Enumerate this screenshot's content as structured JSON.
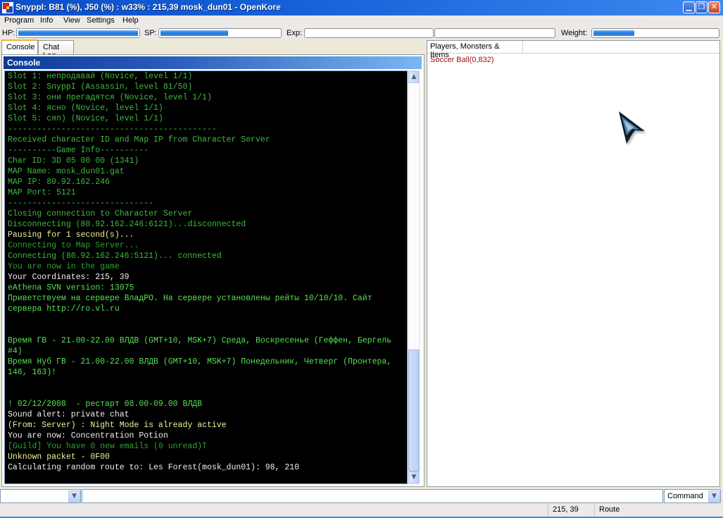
{
  "window": {
    "title": "SnyppI: B81 (%), J50 (%) : w33% : 215,39 mosk_dun01 - OpenKore",
    "icon": "openkore-app-icon",
    "controls": {
      "minimize": "minimize-icon",
      "restore": "restore-icon",
      "close": "close-icon"
    }
  },
  "menu": {
    "items": [
      "Program",
      "Info",
      "View",
      "Settings",
      "Help"
    ]
  },
  "stats": {
    "hp": {
      "label": "HP:",
      "percent": 100
    },
    "sp": {
      "label": "SP:",
      "percent": 57
    },
    "exp": {
      "label": "Exp:",
      "base_percent": 0,
      "job_percent": 0
    },
    "weight": {
      "label": "Weight:",
      "percent": 33
    }
  },
  "tabs": [
    {
      "label": "Console",
      "active": true
    },
    {
      "label": "Chat Log",
      "active": false
    }
  ],
  "console": {
    "header": "Console",
    "colors": {
      "green": "#3fb83f",
      "bright_green": "#55e055",
      "white": "#f0f0f0",
      "yellow": "#f0f0a0",
      "dim_green": "#30a030"
    },
    "lines": [
      {
        "text": "Slot 1: непродавай (Novice, level 1/1)",
        "color": "green"
      },
      {
        "text": "Slot 2: SnyppI (Assassin, level 81/50)",
        "color": "green"
      },
      {
        "text": "Slot 3: они прегадятся (Novice, level 1/1)",
        "color": "green"
      },
      {
        "text": "Slot 4: ясно (Novice, level 1/1)",
        "color": "green"
      },
      {
        "text": "Slot 5: сяп) (Novice, level 1/1)",
        "color": "green"
      },
      {
        "text": "-------------------------------------------",
        "color": "green"
      },
      {
        "text": "Received character ID and Map IP from Character Server",
        "color": "green"
      },
      {
        "text": "----------Game Info----------",
        "color": "green"
      },
      {
        "text": "Char ID: 3D 05 00 00 (1341)",
        "color": "green"
      },
      {
        "text": "MAP Name: mosk_dun01.gat",
        "color": "green"
      },
      {
        "text": "MAP IP: 80.92.162.246",
        "color": "green"
      },
      {
        "text": "MAP Port: 5121",
        "color": "green"
      },
      {
        "text": "------------------------------",
        "color": "green"
      },
      {
        "text": "Closing connection to Character Server",
        "color": "green"
      },
      {
        "text": "Disconnecting (80.92.162.246:6121)...disconnected",
        "color": "green"
      },
      {
        "text": "Pausing for 1 second(s)...",
        "color": "yellow"
      },
      {
        "text": "Connecting to Map Server...",
        "color": "dim_green"
      },
      {
        "text": "Connecting (80.92.162.246:5121)... connected",
        "color": "green"
      },
      {
        "text": "You are now in the game",
        "color": "dim_green"
      },
      {
        "text": "Your Coordinates: 215, 39",
        "color": "white"
      },
      {
        "text": "eAthena SVN version: 13075",
        "color": "bright_green"
      },
      {
        "text": "Приветствуем на сервере ВладРО. На сервере установлены рейты 10/10/10. Сайт",
        "color": "bright_green"
      },
      {
        "text": "сервера http://ro.vl.ru",
        "color": "bright_green"
      },
      {
        "text": "",
        "color": "green"
      },
      {
        "text": "",
        "color": "green"
      },
      {
        "text": "Время ГВ - 21.00-22.00 ВЛДВ (GMT+10, MSK+7) Среда, Воскресенье (Геффен, Бергель",
        "color": "bright_green"
      },
      {
        "text": "#4)",
        "color": "bright_green"
      },
      {
        "text": "Время Нуб ГВ - 21.00-22.00 ВЛДВ (GMT+10, MSK+7) Понедельник, Четверг (Пронтера,",
        "color": "bright_green"
      },
      {
        "text": "146, 163)!",
        "color": "bright_green"
      },
      {
        "text": "",
        "color": "green"
      },
      {
        "text": "",
        "color": "green"
      },
      {
        "text": "! 02/12/2008  - рестарт 08.00-09.00 ВЛДВ",
        "color": "bright_green"
      },
      {
        "text": "Sound alert: private chat",
        "color": "white"
      },
      {
        "text": "(From: Server) : Night Mode is already active",
        "color": "yellow"
      },
      {
        "text": "You are now: Concentration Potion",
        "color": "white"
      },
      {
        "text": "[Guild] You have 0 new emails (0 unread)T",
        "color": "dim_green"
      },
      {
        "text": "Unknown packet - 0F00",
        "color": "yellow"
      },
      {
        "text": "Calculating random route to: Les Forest(mosk_dun01): 98, 210",
        "color": "white"
      }
    ],
    "scrollbar": {
      "position_percent": 100
    }
  },
  "right_panel": {
    "header": "Players, Monsters & Items",
    "items": [
      {
        "text": "Soccer Ball(0,832)",
        "color": "#a01010"
      }
    ]
  },
  "input_bar": {
    "history_value": "",
    "command_value": "",
    "mode_value": "Command"
  },
  "status_bar": {
    "coordinates": "215, 39",
    "state": "Route"
  }
}
